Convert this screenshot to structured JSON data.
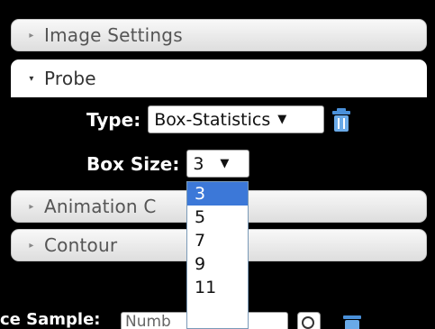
{
  "sections": [
    {
      "label": "Image Settings",
      "arrow": "▸"
    },
    {
      "label": "Probe",
      "arrow": "▾"
    },
    {
      "label": "Animation C",
      "arrow": "▸"
    },
    {
      "label": "Contour",
      "arrow": "▸"
    }
  ],
  "probe": {
    "type_label": "Type:",
    "type_value": "Box-Statistics",
    "box_size_label": "Box Size:",
    "box_size_value": "3"
  },
  "box_size_options": [
    "3",
    "5",
    "7",
    "9",
    "11"
  ],
  "bottom": {
    "label": "ce Sample:",
    "input_value": "Numb"
  },
  "colors": {
    "selected_option": "#3c78d8",
    "trash_icon": "#4a90d9"
  }
}
